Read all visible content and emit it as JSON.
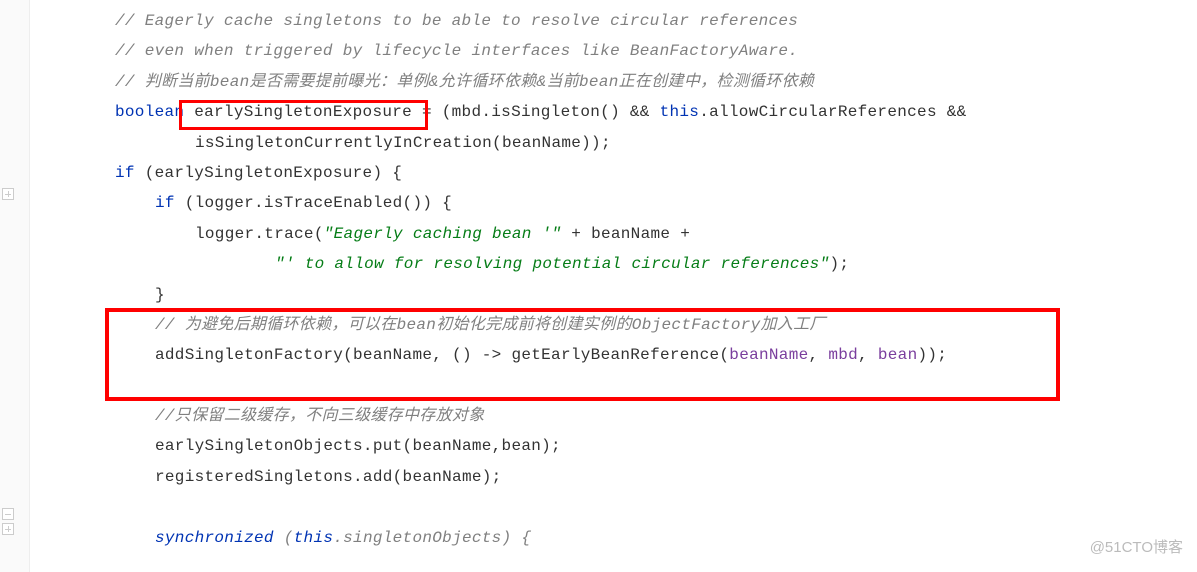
{
  "lines": {
    "l1": "// Eagerly cache singletons to be able to resolve circular references",
    "l2": "// even when triggered by lifecycle interfaces like BeanFactoryAware.",
    "l3": "// 判断当前bean是否需要提前曝光：单例&允许循环依赖&当前bean正在创建中，检测循环依赖",
    "l4_boolean": "boolean",
    "l4_var": " earlySingletonExposure ",
    "l4_rest1": "= (mbd.isSingleton() && ",
    "l4_this": "this",
    "l4_rest2": ".allowCircularReferences &&",
    "l5": "isSingletonCurrentlyInCreation(beanName));",
    "l6_if": "if ",
    "l6_cond": "(earlySingletonExposure) {",
    "l7_if": "if ",
    "l7_cond": "(logger.isTraceEnabled()) {",
    "l8_a": "logger.trace(",
    "l8_str": "\"Eagerly caching bean '\"",
    "l8_b": " + beanName +",
    "l9_str": "\"' to allow for resolving potential circular references\"",
    "l9_b": ");",
    "l10": "}",
    "l11": "// 为避免后期循环依赖，可以在bean初始化完成前将创建实例的ObjectFactory加入工厂",
    "l12_a": "addSingletonFactory(beanName, () -> getEarlyBeanReference(",
    "l12_p1": "beanName",
    "l12_c1": ", ",
    "l12_p2": "mbd",
    "l12_c2": ", ",
    "l12_p3": "bean",
    "l12_b": "));",
    "l13": "//只保留二级缓存，不向三级缓存中存放对象",
    "l14": "earlySingletonObjects.put(beanName,bean);",
    "l15": "registeredSingletons.add(beanName);",
    "l16_sync": "synchronized ",
    "l16_open": "(",
    "l16_this": "this",
    "l16_rest": ".singletonObjects) {"
  },
  "watermark": "@51CTO博客"
}
